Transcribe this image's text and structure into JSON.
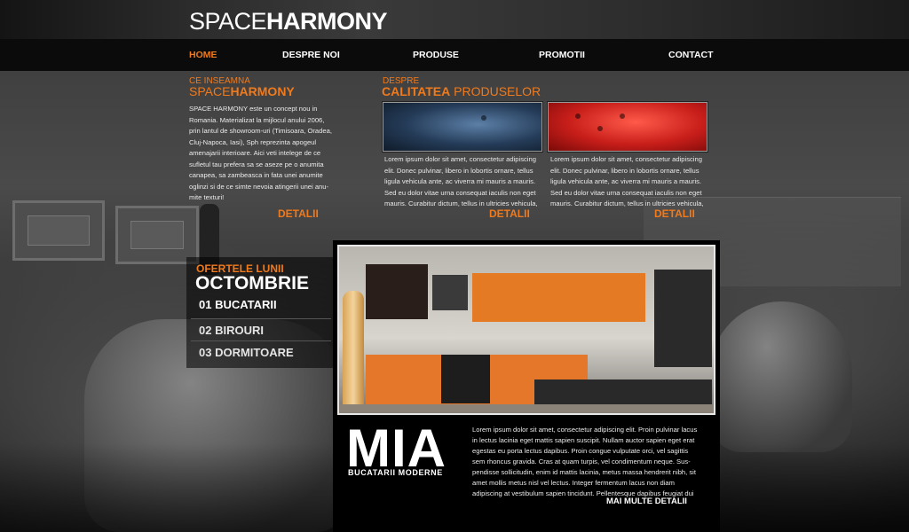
{
  "brand": {
    "logo_light": "SPACE",
    "logo_bold": "HARMONY"
  },
  "nav": [
    {
      "label": "HOME",
      "active": true
    },
    {
      "label": "DESPRE NOI"
    },
    {
      "label": "PRODUSE"
    },
    {
      "label": "PROMOTII"
    },
    {
      "label": "CONTACT"
    }
  ],
  "about": {
    "kicker": "CE INSEAMNA",
    "title_light": "SPACE",
    "title_bold": "HARMONY",
    "text": "SPACE HARMONY este un concept nou in Romania. Materializat la mijlocul anului 2006, prin lantul de showroom-uri (Timisoara, Oradea, Cluj-Napoca, Iasi), Sph reprezinta apogeul amenajarii interioare. Aici veti intelege de ce sufletul tau prefera sa se aseze pe o anumita canapea, sa zambeasca in fata unei anumite oglinzi si de ce simte nevoia atingerii unei anu-mite texturi!",
    "details_label": "DETALII"
  },
  "quality": {
    "kicker": "DESPRE",
    "title_bold": "CALITATEA",
    "title_light": " PRODUSELOR",
    "products": [
      {
        "text": "Lorem ipsum dolor sit amet, consectetur adipiscing elit. Donec pulvinar, libero in lobortis ornare, tellus ligula vehicula ante, ac viverra mi mauris a mauris. Sed eu dolor vitae urna consequat iaculis non eget mauris. Curabitur dictum, tellus in ultricies vehicula,",
        "details_label": "DETALII"
      },
      {
        "text": "Lorem ipsum dolor sit amet, consectetur adipiscing elit. Donec pulvinar, libero in lobortis ornare, tellus ligula vehicula ante, ac viverra mi mauris a mauris. Sed eu dolor vitae urna consequat iaculis non eget mauris. Curabitur dictum, tellus in ultricies vehicula,",
        "details_label": "DETALII"
      }
    ]
  },
  "offers": {
    "kicker": "OFERTELE LUNII",
    "month": "OCTOMBRIE",
    "items": [
      "01 BUCATARII",
      "02 BIROURI",
      "03 DORMITOARE"
    ]
  },
  "feature": {
    "name": "MIA",
    "subtitle": "BUCATARII MODERNE",
    "text": "Lorem ipsum dolor sit amet, consectetur adipiscing elit. Proin pulvinar lacus in lectus lacinia eget mattis sapien suscipit. Nullam auctor sapien eget erat egestas eu porta lectus dapibus. Proin congue vulputate orci, vel sagittis sem rhoncus gravida. Cras at quam turpis, vel condimentum neque. Sus-pendisse sollicitudin, enim id mattis lacinia, metus massa hendrerit nibh, sit amet mollis metus nisl vel lectus. Integer fermentum lacus non diam adipiscing at vestibulum sapien tincidunt. Pellentesque dapibus feugiat dui",
    "more_label": "MAI MULTE DETALII"
  },
  "colors": {
    "accent": "#f07a1c",
    "background": "#1a1a1a",
    "text": "#eaeaea"
  }
}
